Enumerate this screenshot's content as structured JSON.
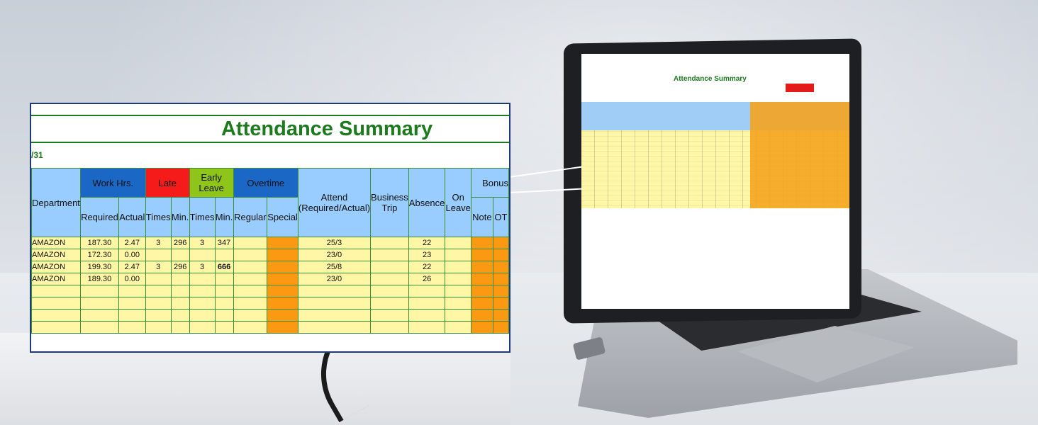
{
  "sheet": {
    "title": "Attendance Summary",
    "period_fragment": "/31"
  },
  "headers": {
    "department": "Department",
    "work_hrs": "Work Hrs.",
    "late": "Late",
    "early_leave": "Early Leave",
    "overtime": "Overtime",
    "attend": "Attend (Required/Actual)",
    "business_trip": "Business Trip",
    "absence": "Absence",
    "on_leave": "On Leave",
    "bonus": "Bonus",
    "required": "Required",
    "actual": "Actual",
    "late_times": "Times",
    "late_min": "Min.",
    "early_times": "Times",
    "early_min": "Min.",
    "regular": "Regular",
    "special": "Special",
    "note": "Note",
    "ot": "OT"
  },
  "rows": [
    {
      "dept": "AMAZON",
      "required": "187.30",
      "actual": "2.47",
      "late_times": "3",
      "late_min": "296",
      "early_times": "3",
      "early_min": "347",
      "attend": "25/3",
      "absence": "22"
    },
    {
      "dept": "AMAZON",
      "required": "172.30",
      "actual": "0.00",
      "late_times": "",
      "late_min": "",
      "early_times": "",
      "early_min": "",
      "attend": "23/0",
      "absence": "23"
    },
    {
      "dept": "AMAZON",
      "required": "199.30",
      "actual": "2.47",
      "late_times": "3",
      "late_min": "296",
      "early_times": "3",
      "early_min": "666",
      "attend": "25/8",
      "absence": "22"
    },
    {
      "dept": "AMAZON",
      "required": "189.30",
      "actual": "0.00",
      "late_times": "",
      "late_min": "",
      "early_times": "",
      "early_min": "",
      "attend": "23/0",
      "absence": "26"
    }
  ],
  "colors": {
    "title_green": "#1d7a1d",
    "header_light_blue": "#99ccff",
    "header_blue": "#1a67c6",
    "late_red": "#f51b1b",
    "early_green": "#8fc41a",
    "row_yellow": "#fff7a6",
    "bonus_orange": "#fb9a12"
  }
}
